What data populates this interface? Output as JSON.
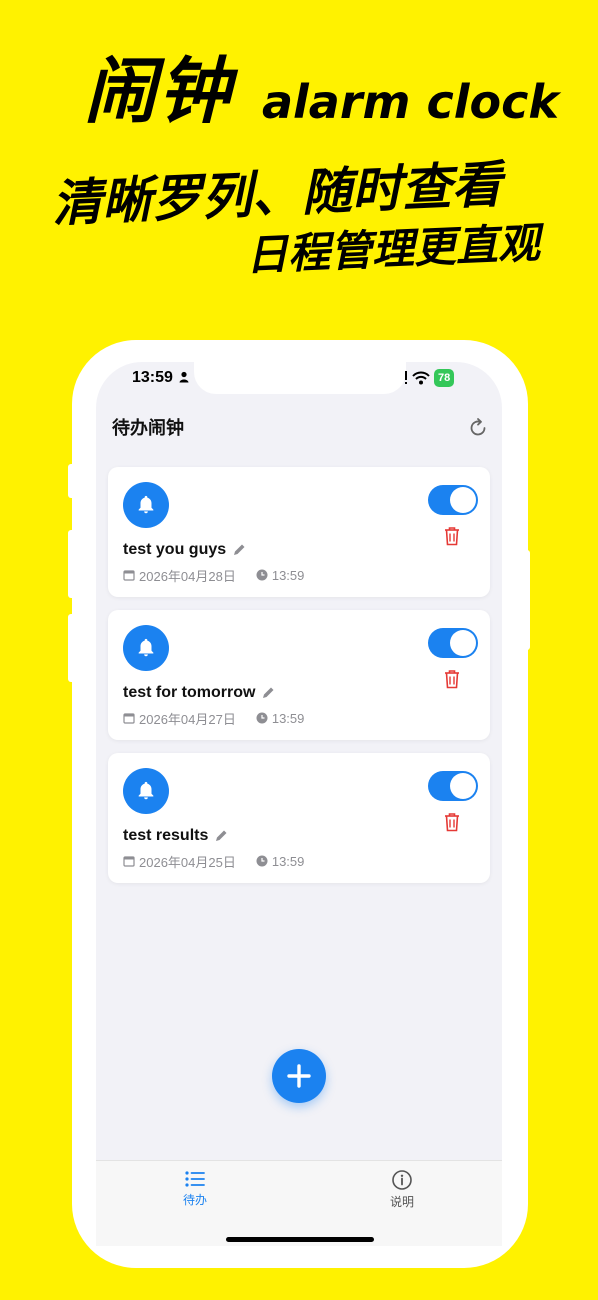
{
  "promo": {
    "title_cn": "闹钟",
    "title_en": "alarm clock",
    "line1": "清晰罗列、随时查看",
    "line2": "日程管理更直观"
  },
  "status_bar": {
    "time": "13:59",
    "battery": "78"
  },
  "header": {
    "title": "待办闹钟",
    "refresh_icon": "refresh-icon"
  },
  "alarms": [
    {
      "title": "test you guys",
      "date": "2026年04月28日",
      "time": "13:59",
      "enabled": true
    },
    {
      "title": "test for tomorrow",
      "date": "2026年04月27日",
      "time": "13:59",
      "enabled": true
    },
    {
      "title": "test results",
      "date": "2026年04月25日",
      "time": "13:59",
      "enabled": true
    }
  ],
  "tabs": [
    {
      "label": "待办",
      "icon": "list-icon",
      "active": true
    },
    {
      "label": "说明",
      "icon": "info-icon",
      "active": false
    }
  ],
  "colors": {
    "accent": "#1B82F0",
    "delete": "#E53935",
    "background": "#FFF200",
    "battery": "#34C759"
  }
}
